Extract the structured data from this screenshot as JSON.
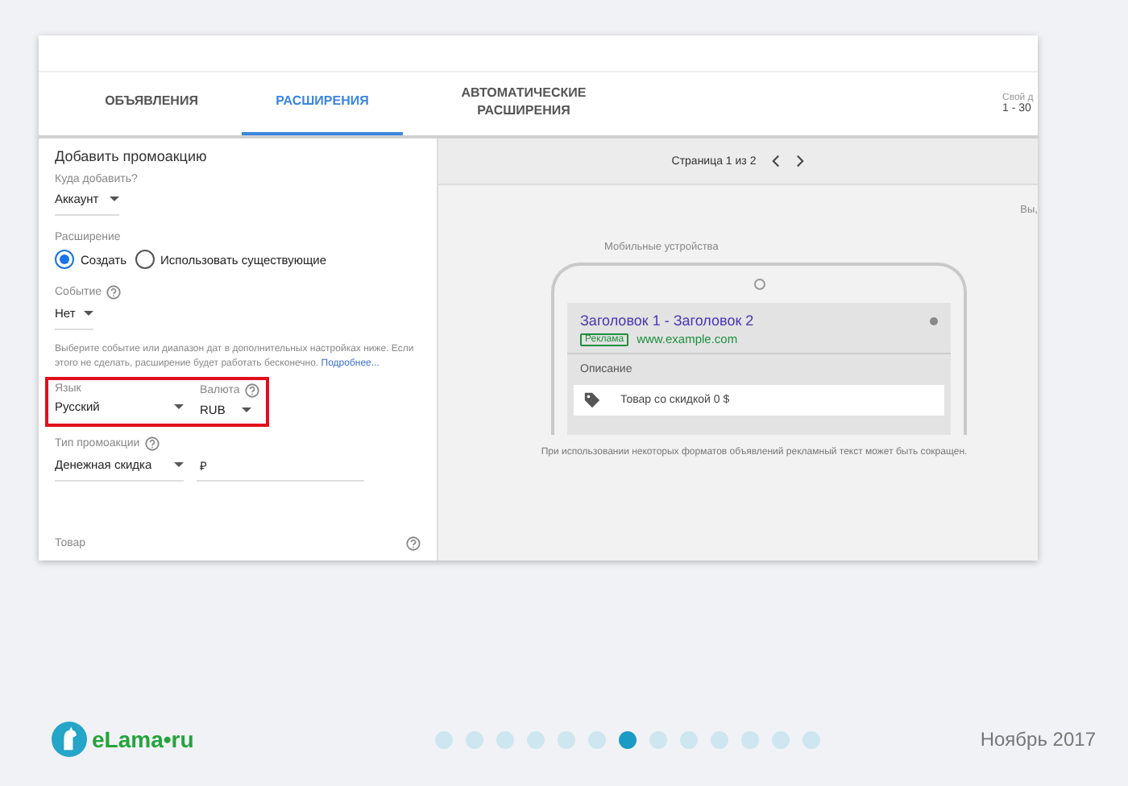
{
  "tabs": [
    {
      "label": "ОБЪЯВЛЕНИЯ",
      "selected": false
    },
    {
      "label": "РАСШИРЕНИЯ",
      "selected": true
    },
    {
      "label": "АВТОМАТИЧЕСКИЕ РАСШИРЕНИЯ",
      "selected": false
    }
  ],
  "date_range": {
    "label": "Свой д",
    "value": "1 - 30"
  },
  "form": {
    "title": "Добавить промоакцию",
    "target": {
      "label": "Куда добавить?",
      "value": "Аккаунт"
    },
    "extension": {
      "label": "Расширение",
      "options": [
        {
          "label": "Создать",
          "selected": true
        },
        {
          "label": "Использовать существующие",
          "selected": false
        }
      ]
    },
    "event": {
      "label": "Событие",
      "value": "Нет"
    },
    "hint": "Выберите событие или диапазон дат в дополнительных настройках ниже. Если этого не сделать, расширение будет работать бесконечно.",
    "hint_link": "Подробнее...",
    "language": {
      "label": "Язык",
      "value": "Русский"
    },
    "currency": {
      "label": "Валюта",
      "value": "RUB"
    },
    "promo_type": {
      "label": "Тип промоакции",
      "value": "Денежная скидка"
    },
    "amount": {
      "placeholder": "₽"
    },
    "product": {
      "label": "Товар"
    }
  },
  "preview": {
    "pager": "Страница 1 из 2",
    "cut_text": "Вы,",
    "device_label": "Мобильные устройства",
    "ad": {
      "headline": "Заголовок 1 - Заголовок 2",
      "badge": "Реклама",
      "url": "www.example.com",
      "description": "Описание",
      "promo": "Товар со скидкой 0 $"
    },
    "note": "При использовании некоторых форматов объявлений рекламный текст может быть сокращен."
  },
  "footer": {
    "logo": "eLama•ru",
    "date": "Ноябрь 2017",
    "dots": [
      {
        "selected": false
      },
      {
        "selected": false
      },
      {
        "selected": false
      },
      {
        "selected": false
      },
      {
        "selected": false
      },
      {
        "selected": false
      },
      {
        "selected": true
      },
      {
        "selected": false
      },
      {
        "selected": false
      },
      {
        "selected": false
      },
      {
        "selected": false
      },
      {
        "selected": false
      },
      {
        "selected": false
      }
    ]
  }
}
